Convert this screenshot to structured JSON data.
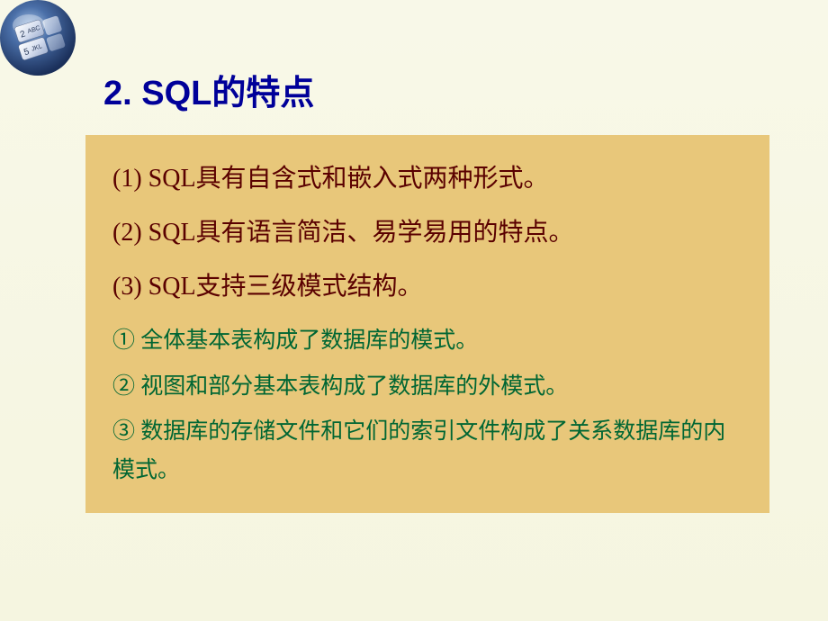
{
  "title": "2. SQL的特点",
  "items": {
    "p1": "(1) SQL具有自含式和嵌入式两种形式。",
    "p2": "(2) SQL具有语言简洁、易学易用的特点。",
    "p3": "(3) SQL支持三级模式结构。",
    "s1": "① 全体基本表构成了数据库的模式。",
    "s2": "② 视图和部分基本表构成了数据库的外模式。",
    "s3": "③ 数据库的存储文件和它们的索引文件构成了关系数据库的内模式。"
  }
}
